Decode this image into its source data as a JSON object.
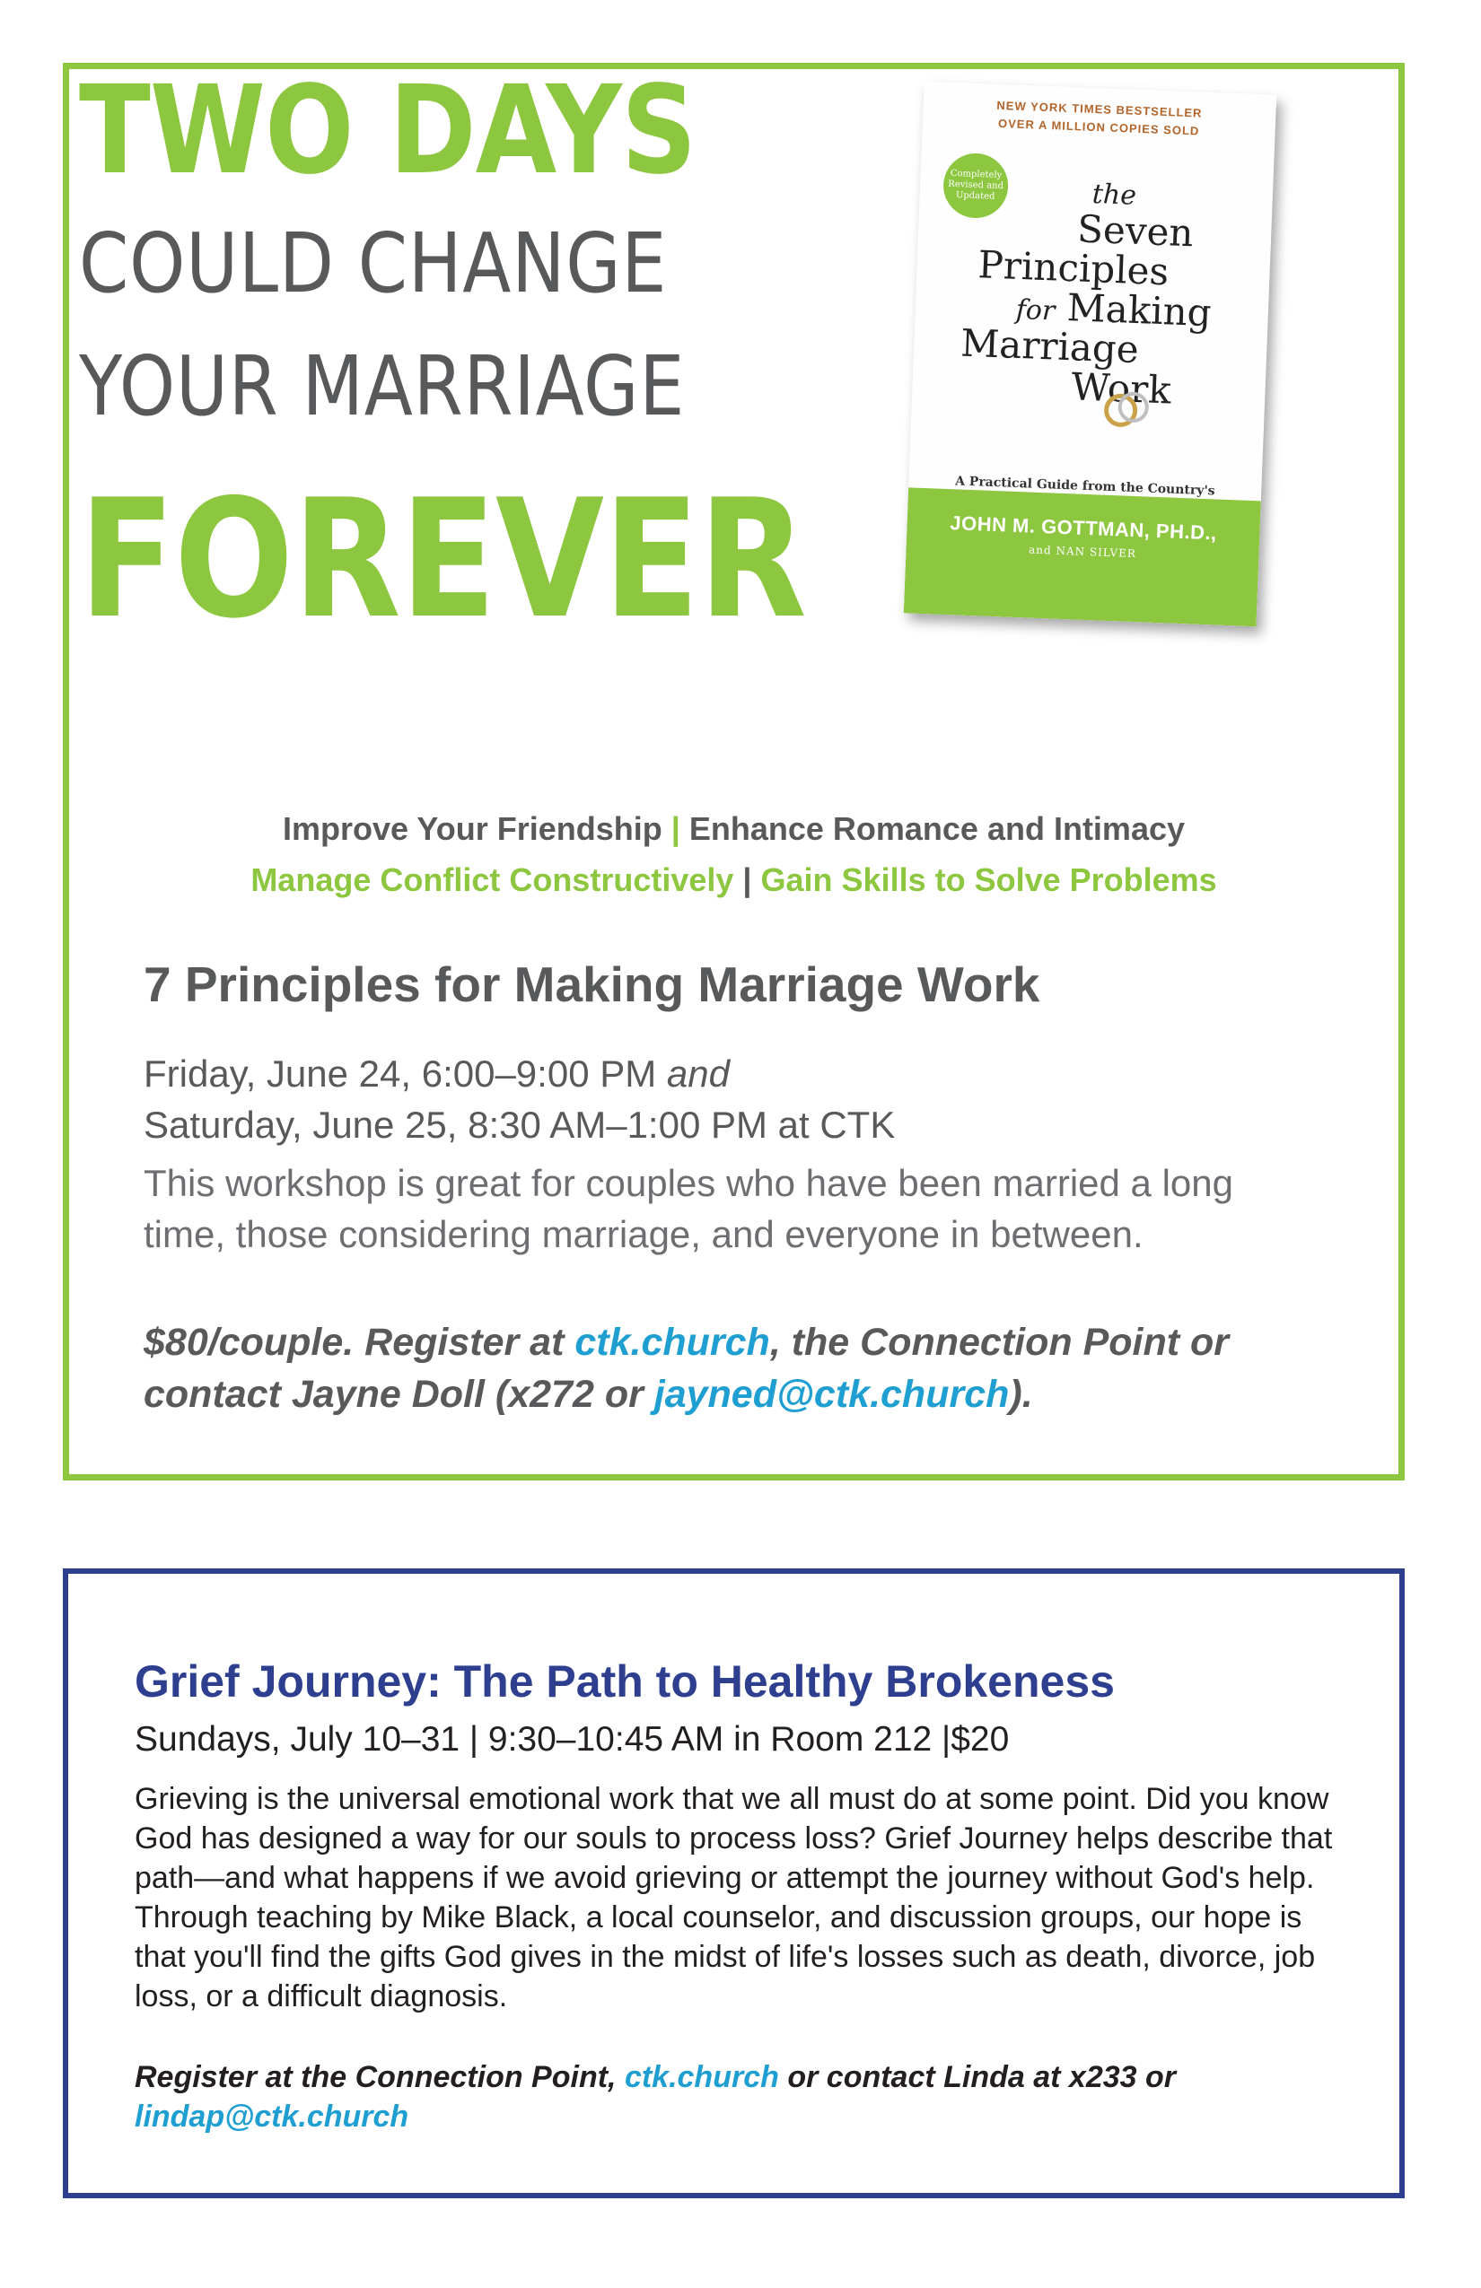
{
  "headline": {
    "line1": "TWO DAYS",
    "line2": "COULD  CHANGE",
    "line3": "YOUR MARRIAGE",
    "line4": "FOREVER"
  },
  "book": {
    "top_line1": "NEW YORK TIMES BESTSELLER",
    "top_line2": "OVER A MILLION COPIES SOLD",
    "seal": "Completely Revised and Updated",
    "title_the": "the",
    "title_seven": "Seven",
    "title_principles": "Principles",
    "title_for": "for",
    "title_making": "Making",
    "title_marriage": "Marriage",
    "title_work": "Work",
    "subtitle": "A Practical Guide from the Country's Foremost Relationship Expert",
    "author": "JOHN M. GOTTMAN, PH.D.,",
    "coauthor": "and NAN SILVER",
    "icon": "wedding-rings-icon"
  },
  "benefits": {
    "b1": "Improve Your Friendship",
    "b2": "Enhance Romance and Intimacy",
    "b3": "Manage Conflict Constructively",
    "b4": "Gain Skills to Solve Problems",
    "separator": "|"
  },
  "workshop": {
    "title": "7 Principles for Making Marriage Work",
    "date1": "Friday, June 24, 6:00–9:00 PM",
    "and": "and",
    "date2": "Saturday, June 25, 8:30 AM–1:00 PM at CTK",
    "description": "This workshop is great for couples who have been married a long time, those considering marriage, and everyone in between.",
    "reg_1": "$80/couple. Register at ",
    "reg_link1": "ctk.church",
    "reg_2": ", the Connection Point or contact Jayne Doll (x272 or ",
    "reg_link2": "jayned@ctk.church",
    "reg_3": ")."
  },
  "grief": {
    "title": "Grief Journey: The Path to Healthy Brokeness",
    "subtitle": "Sundays, July 10–31 | 9:30–10:45 AM in Room 212 |$20",
    "body": "Grieving is the universal emotional work that we all must do at some point. Did you know God has designed a way for our souls to process loss? Grief Journey helps describe that path—and what happens if we avoid grieving or attempt the journey without God's help. Through teaching by Mike Black, a local counselor, and discussion groups, our hope is that you'll find the gifts God gives in the midst of life's losses such as death, divorce, job loss, or a difficult diagnosis.",
    "reg_1": "Register at the Connection Point, ",
    "reg_link1": "ctk.church",
    "reg_2": " or contact Linda at x233 or ",
    "reg_link2": "lindap@ctk.church"
  },
  "colors": {
    "green": "#8dc63f",
    "gray": "#58595b",
    "navy": "#2e3f8f",
    "link": "#1f9fd1"
  }
}
